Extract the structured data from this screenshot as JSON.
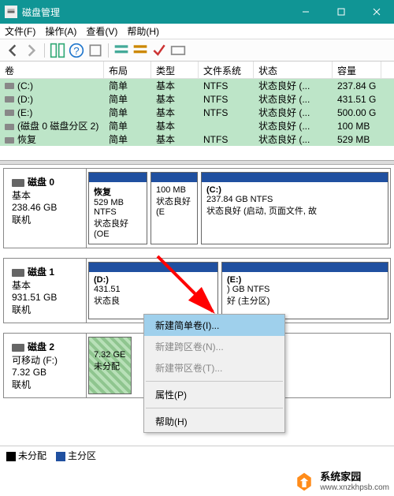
{
  "titlebar": {
    "title": "磁盘管理"
  },
  "menu": {
    "file": "文件(F)",
    "action": "操作(A)",
    "view": "查看(V)",
    "help": "帮助(H)"
  },
  "columns": {
    "vol": "卷",
    "layout": "布局",
    "type": "类型",
    "fs": "文件系统",
    "status": "状态",
    "cap": "容量"
  },
  "volumes": [
    {
      "name": "(C:)",
      "layout": "简单",
      "type": "基本",
      "fs": "NTFS",
      "status": "状态良好 (...",
      "cap": "237.84 G"
    },
    {
      "name": "(D:)",
      "layout": "简单",
      "type": "基本",
      "fs": "NTFS",
      "status": "状态良好 (...",
      "cap": "431.51 G"
    },
    {
      "name": "(E:)",
      "layout": "简单",
      "type": "基本",
      "fs": "NTFS",
      "status": "状态良好 (...",
      "cap": "500.00 G"
    },
    {
      "name": "(磁盘 0 磁盘分区 2)",
      "layout": "简单",
      "type": "基本",
      "fs": "",
      "status": "状态良好 (...",
      "cap": "100 MB"
    },
    {
      "name": "恢复",
      "layout": "简单",
      "type": "基本",
      "fs": "NTFS",
      "status": "状态良好 (...",
      "cap": "529 MB"
    }
  ],
  "disks": {
    "d0": {
      "name": "磁盘 0",
      "type": "基本",
      "size": "238.46 GB",
      "status": "联机",
      "p1": {
        "name": "恢复",
        "line2": "529 MB NTFS",
        "line3": "状态良好 (OE"
      },
      "p2": {
        "name": "",
        "line2": "100 MB",
        "line3": "状态良好 (E"
      },
      "p3": {
        "name": "(C:)",
        "line2": "237.84 GB NTFS",
        "line3": "状态良好 (启动, 页面文件, 故"
      }
    },
    "d1": {
      "name": "磁盘 1",
      "type": "基本",
      "size": "931.51 GB",
      "status": "联机",
      "p1": {
        "name": "(D:)",
        "line2": "431.51",
        "line3": "状态良"
      },
      "p2": {
        "name": "(E:)",
        "line2": ") GB NTFS",
        "line3": "好 (主分区)"
      }
    },
    "d2": {
      "name": "磁盘 2",
      "type": "可移动 (F:)",
      "size": "7.32 GB",
      "status": "联机",
      "p1": {
        "name": "",
        "line2": "7.32 GE",
        "line3": "未分配"
      }
    }
  },
  "ctx": {
    "new_simple": "新建简单卷(I)...",
    "new_span": "新建跨区卷(N)...",
    "new_stripe": "新建带区卷(T)...",
    "properties": "属性(P)",
    "help": "帮助(H)"
  },
  "legend": {
    "unalloc": "未分配",
    "primary": "主分区"
  },
  "watermark": {
    "brand": "系统家园",
    "url": "www.xnzkhpsb.com"
  }
}
